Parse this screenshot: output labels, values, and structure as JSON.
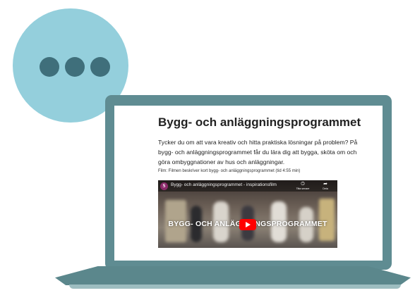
{
  "colors": {
    "bubble": "#94cfdc",
    "bubble_dots": "#3f6f7b",
    "laptop": "#5f8c92",
    "play_button": "#ff0000"
  },
  "page": {
    "title": "Bygg- och anläggningsprogrammet",
    "intro": "Tycker du om att vara kreativ och hitta praktiska lösningar på problem? På bygg- och anläggningsprogrammet får du lära dig att bygga, sköta om och göra ombyggnationer av hus och anläggningar.",
    "caption": "Film: Filmen beskriver kort bygg- och anläggningsprogrammet (tid 4:55 min)"
  },
  "video": {
    "channel_icon_letter": "S",
    "title": "Bygg- och anläggningsprogrammet - inspirationsfilm",
    "watch_later_label": "Titta senare",
    "share_label": "Dela",
    "overlay_text": "BYGG- OCH ANLÄGGNINGSPROGRAMMET"
  },
  "icons": {
    "chat_bubble": "speech-bubble-icon",
    "watch_later": "clock-icon",
    "share": "share-arrow-icon",
    "play": "play-icon"
  }
}
